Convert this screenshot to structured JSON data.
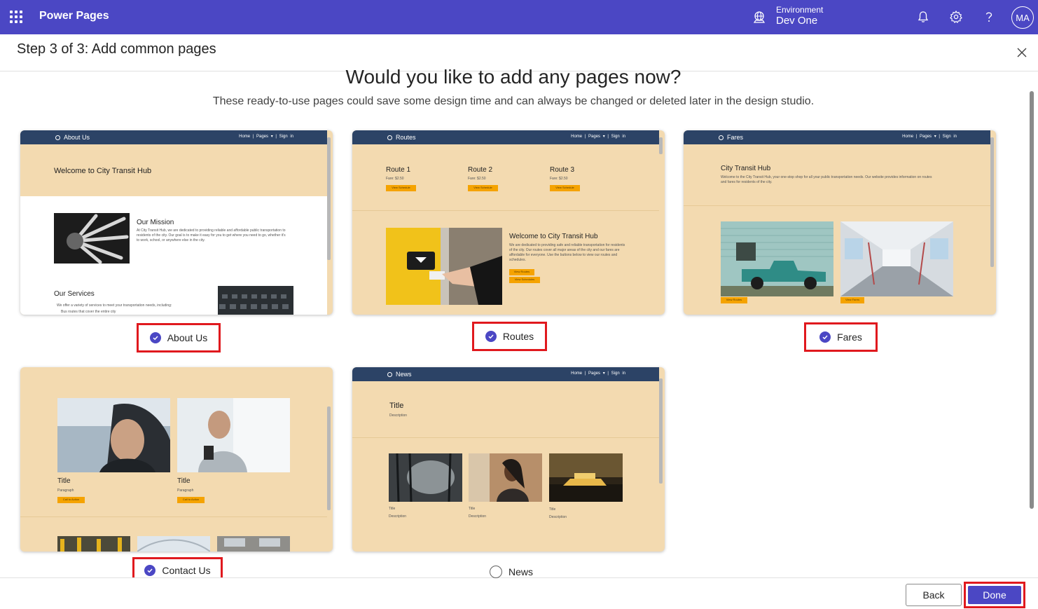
{
  "topbar": {
    "app_name": "Power Pages",
    "environment_label": "Environment",
    "environment_value": "Dev One",
    "avatar_initials": "MA"
  },
  "header": {
    "step_title": "Step 3 of 3: Add common pages"
  },
  "main": {
    "question": "Would you like to add any pages now?",
    "subtitle": "These ready-to-use pages could save some design time and can always be changed or deleted later in the design studio."
  },
  "preview_nav": {
    "home": "Home",
    "pages": "Pages ▾",
    "signin": "Sign in"
  },
  "cards": {
    "about": {
      "option_label": "About Us",
      "selected": true,
      "nav_title": "About Us",
      "hero": "Welcome to City Transit Hub",
      "mission_title": "Our Mission",
      "mission_text": "At City Transit Hub, we are dedicated to providing reliable and affordable public transportation to residents of the city. Our goal is to make it easy for you to get where you need to go, whether it's to work, school, or anywhere else in the city.",
      "services_title": "Our Services",
      "services_text": "We offer a variety of services to meet your transportation needs, including:",
      "services_item": "Bus routes that cover the entire city"
    },
    "routes": {
      "option_label": "Routes",
      "selected": true,
      "nav_title": "Routes",
      "routes": [
        {
          "name": "Route 1",
          "fare": "Fare: $2.50",
          "button": "View Schedule"
        },
        {
          "name": "Route 2",
          "fare": "Fare: $2.50",
          "button": "View Schedule"
        },
        {
          "name": "Route 3",
          "fare": "Fare: $2.50",
          "button": "View Schedule"
        }
      ],
      "welcome_title": "Welcome to City Transit Hub",
      "welcome_text": "We are dedicated to providing safe and reliable transportation for residents of the city. Our routes cover all major areas of the city and our fares are affordable for everyone. Use the buttons below to view our routes and schedules.",
      "btn_routes": "View Routes",
      "btn_schedules": "View Schedules"
    },
    "fares": {
      "option_label": "Fares",
      "selected": true,
      "nav_title": "Fares",
      "title": "City Transit Hub",
      "text": "Welcome to the City Transit Hub, your one-stop shop for all your public transportation needs. Our website provides information on routes and fares for residents of the city.",
      "btn_routes": "View Routes",
      "btn_fares": "View Fares"
    },
    "contact": {
      "option_label": "Contact Us",
      "selected": true,
      "col1_title": "Title",
      "col1_para": "Paragraph",
      "col1_btn": "Call to Action",
      "col2_title": "Title",
      "col2_para": "Paragraph",
      "col2_btn": "Call to Action"
    },
    "news": {
      "option_label": "News",
      "selected": false,
      "nav_title": "News",
      "title": "Title",
      "description": "Description",
      "items": [
        {
          "title": "Title",
          "description": "Description"
        },
        {
          "title": "Title",
          "description": "Description"
        },
        {
          "title": "Title",
          "description": "Description"
        }
      ]
    }
  },
  "footer": {
    "back_label": "Back",
    "done_label": "Done"
  },
  "colors": {
    "brand": "#4b47c4",
    "card_bg": "#f3dab0",
    "nav_bg": "#2c4366",
    "highlight": "#e0191e",
    "accent_button": "#f5a300"
  }
}
